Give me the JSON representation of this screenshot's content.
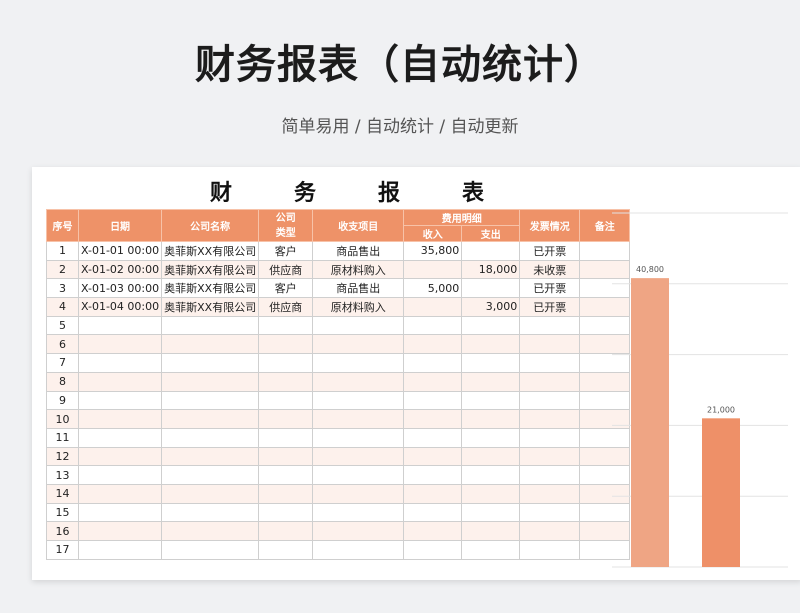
{
  "header": {
    "title": "财务报表（自动统计）",
    "subtitle": "简单易用  /  自动统计  /  自动更新"
  },
  "sheet": {
    "title": "财务报表",
    "columns": {
      "seq": "序号",
      "date": "日期",
      "company": "公司名称",
      "company_type": "公司类型",
      "item": "收支项目",
      "fee_detail": "费用明细",
      "income": "收入",
      "expense": "支出",
      "invoice": "发票情况",
      "note": "备注"
    },
    "rows": [
      {
        "seq": "1",
        "date": "X-01-01 00:00",
        "company": "奥菲斯XX有限公司",
        "type": "客户",
        "item": "商品售出",
        "income": "35,800",
        "expense": "",
        "invoice": "已开票",
        "note": ""
      },
      {
        "seq": "2",
        "date": "X-01-02 00:00",
        "company": "奥菲斯XX有限公司",
        "type": "供应商",
        "item": "原材料购入",
        "income": "",
        "expense": "18,000",
        "invoice": "未收票",
        "note": ""
      },
      {
        "seq": "3",
        "date": "X-01-03 00:00",
        "company": "奥菲斯XX有限公司",
        "type": "客户",
        "item": "商品售出",
        "income": "5,000",
        "expense": "",
        "invoice": "已开票",
        "note": ""
      },
      {
        "seq": "4",
        "date": "X-01-04 00:00",
        "company": "奥菲斯XX有限公司",
        "type": "供应商",
        "item": "原材料购入",
        "income": "",
        "expense": "3,000",
        "invoice": "已开票",
        "note": ""
      },
      {
        "seq": "5",
        "date": "",
        "company": "",
        "type": "",
        "item": "",
        "income": "",
        "expense": "",
        "invoice": "",
        "note": ""
      },
      {
        "seq": "6",
        "date": "",
        "company": "",
        "type": "",
        "item": "",
        "income": "",
        "expense": "",
        "invoice": "",
        "note": ""
      },
      {
        "seq": "7",
        "date": "",
        "company": "",
        "type": "",
        "item": "",
        "income": "",
        "expense": "",
        "invoice": "",
        "note": ""
      },
      {
        "seq": "8",
        "date": "",
        "company": "",
        "type": "",
        "item": "",
        "income": "",
        "expense": "",
        "invoice": "",
        "note": ""
      },
      {
        "seq": "9",
        "date": "",
        "company": "",
        "type": "",
        "item": "",
        "income": "",
        "expense": "",
        "invoice": "",
        "note": ""
      },
      {
        "seq": "10",
        "date": "",
        "company": "",
        "type": "",
        "item": "",
        "income": "",
        "expense": "",
        "invoice": "",
        "note": ""
      },
      {
        "seq": "11",
        "date": "",
        "company": "",
        "type": "",
        "item": "",
        "income": "",
        "expense": "",
        "invoice": "",
        "note": ""
      },
      {
        "seq": "12",
        "date": "",
        "company": "",
        "type": "",
        "item": "",
        "income": "",
        "expense": "",
        "invoice": "",
        "note": ""
      },
      {
        "seq": "13",
        "date": "",
        "company": "",
        "type": "",
        "item": "",
        "income": "",
        "expense": "",
        "invoice": "",
        "note": ""
      },
      {
        "seq": "14",
        "date": "",
        "company": "",
        "type": "",
        "item": "",
        "income": "",
        "expense": "",
        "invoice": "",
        "note": ""
      },
      {
        "seq": "15",
        "date": "",
        "company": "",
        "type": "",
        "item": "",
        "income": "",
        "expense": "",
        "invoice": "",
        "note": ""
      },
      {
        "seq": "16",
        "date": "",
        "company": "",
        "type": "",
        "item": "",
        "income": "",
        "expense": "",
        "invoice": "",
        "note": ""
      },
      {
        "seq": "17",
        "date": "",
        "company": "",
        "type": "",
        "item": "",
        "income": "",
        "expense": "",
        "invoice": "",
        "note": ""
      }
    ]
  },
  "colors": {
    "header_fill": "#ee9268",
    "bar_income": "#efa584",
    "bar_expense": "#ee9068",
    "stripe": "#fdf1ec"
  },
  "chart_data": {
    "type": "bar",
    "categories": [
      "",
      ""
    ],
    "values": [
      40800,
      21000
    ],
    "data_labels": [
      "40,800",
      "21,000"
    ],
    "ylim": [
      0,
      50000
    ],
    "grid": true,
    "title": "",
    "xlabel": "",
    "ylabel": ""
  }
}
